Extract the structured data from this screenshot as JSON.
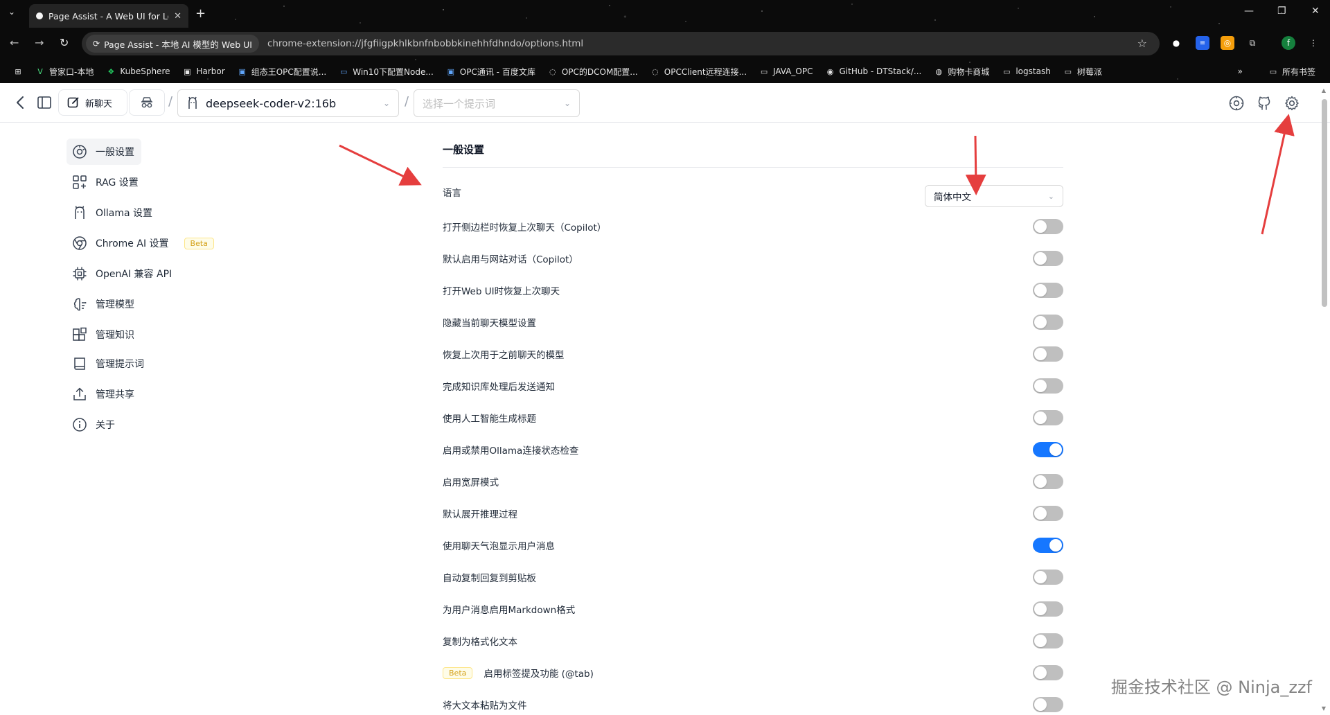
{
  "browser": {
    "tab_title": "Page Assist - A Web UI for Lo",
    "site_chip": "Page Assist - 本地 AI 模型的 Web UI",
    "url": "chrome-extension://jfgfiigpkhlkbnfnbobbkinehhfdhndo/options.html",
    "profile_initial": "f",
    "bookmarks": [
      {
        "icon": "vuetify-icon",
        "label": "管家口-本地"
      },
      {
        "icon": "kubesphere-icon",
        "label": "KubeSphere"
      },
      {
        "icon": "harbor-icon",
        "label": "Harbor"
      },
      {
        "icon": "site-icon",
        "label": "组态王OPC配置说..."
      },
      {
        "icon": "site-icon",
        "label": "Win10下配置Node..."
      },
      {
        "icon": "site-icon",
        "label": "OPC通讯 - 百度文库"
      },
      {
        "icon": "site-icon",
        "label": "OPC的DCOM配置..."
      },
      {
        "icon": "site-icon",
        "label": "OPCClient远程连接..."
      },
      {
        "icon": "folder-icon",
        "label": "JAVA_OPC"
      },
      {
        "icon": "github-icon",
        "label": "GitHub - DTStack/..."
      },
      {
        "icon": "site-icon",
        "label": "购物卡商城"
      },
      {
        "icon": "folder-icon",
        "label": "logstash"
      },
      {
        "icon": "folder-icon",
        "label": "树莓派"
      }
    ],
    "more_bookmarks": "»",
    "all_bookmarks": "所有书签"
  },
  "header": {
    "new_chat_label": "新聊天",
    "slash": "/",
    "model_value": "deepseek-coder-v2:16b",
    "prompt_placeholder": "选择一个提示词"
  },
  "sidebar": {
    "items": [
      {
        "label": "一般设置",
        "icon": "general-settings-icon",
        "active": true
      },
      {
        "label": "RAG 设置",
        "icon": "rag-icon"
      },
      {
        "label": "Ollama 设置",
        "icon": "ollama-icon"
      },
      {
        "label": "Chrome AI 设置",
        "icon": "chrome-icon",
        "badge": "Beta"
      },
      {
        "label": "OpenAI 兼容 API",
        "icon": "chip-icon"
      },
      {
        "label": "管理模型",
        "icon": "brain-icon"
      },
      {
        "label": "管理知识",
        "icon": "blocks-icon"
      },
      {
        "label": "管理提示词",
        "icon": "book-icon"
      },
      {
        "label": "管理共享",
        "icon": "share-icon"
      },
      {
        "label": "关于",
        "icon": "info-icon"
      }
    ]
  },
  "main": {
    "section_title": "一般设置",
    "language_label": "语言",
    "language_value": "简体中文",
    "settings": [
      {
        "label": "打开侧边栏时恢复上次聊天（Copilot）",
        "on": false
      },
      {
        "label": "默认启用与网站对话（Copilot）",
        "on": false
      },
      {
        "label": "打开Web UI时恢复上次聊天",
        "on": false
      },
      {
        "label": "隐藏当前聊天模型设置",
        "on": false
      },
      {
        "label": "恢复上次用于之前聊天的模型",
        "on": false
      },
      {
        "label": "完成知识库处理后发送通知",
        "on": false
      },
      {
        "label": "使用人工智能生成标题",
        "on": false
      },
      {
        "label": "启用或禁用Ollama连接状态检查",
        "on": true
      },
      {
        "label": "启用宽屏模式",
        "on": false
      },
      {
        "label": "默认展开推理过程",
        "on": false
      },
      {
        "label": "使用聊天气泡显示用户消息",
        "on": true
      },
      {
        "label": "自动复制回复到剪贴板",
        "on": false
      },
      {
        "label": "为用户消息启用Markdown格式",
        "on": false
      },
      {
        "label": "复制为格式化文本",
        "on": false
      },
      {
        "label": "启用标签提及功能 (@tab)",
        "on": false,
        "badge": "Beta"
      },
      {
        "label": "将大文本粘贴为文件",
        "on": false
      }
    ]
  },
  "watermark": "掘金技术社区 @ Ninja_zzf",
  "colors": {
    "toggle_on": "#1677ff",
    "toggle_off": "#bfbfbf",
    "annotation_arrow": "#e53e3e",
    "beta_text": "#d4a017"
  }
}
